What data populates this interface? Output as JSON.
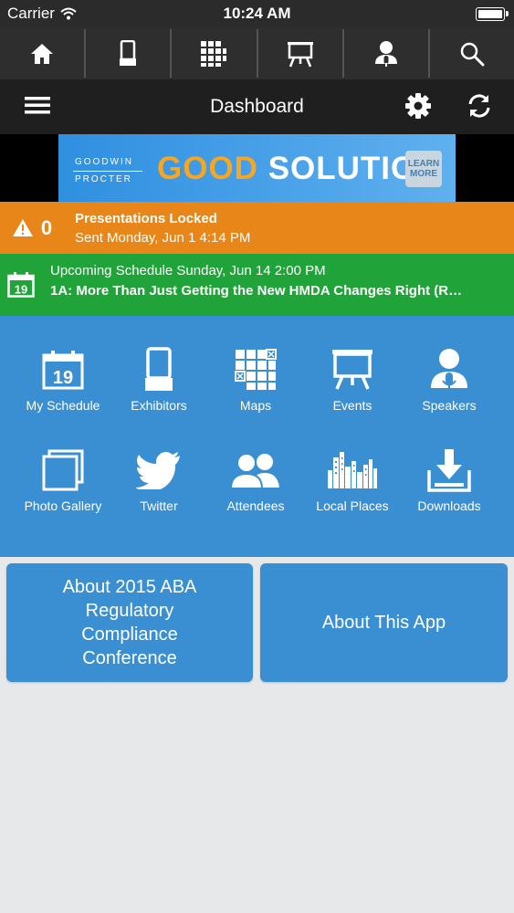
{
  "status_bar": {
    "carrier": "Carrier",
    "time": "10:24 AM"
  },
  "top_nav": [
    {
      "icon": "home-icon"
    },
    {
      "icon": "exhibitors-icon"
    },
    {
      "icon": "maps-icon"
    },
    {
      "icon": "events-icon"
    },
    {
      "icon": "speakers-icon"
    },
    {
      "icon": "search-icon"
    }
  ],
  "title_bar": {
    "title": "Dashboard"
  },
  "banner": {
    "brand_line1": "GOODWIN",
    "brand_line2": "PROCTER",
    "headline_part1": "GOOD",
    "headline_part2": "SOLUTION",
    "learn_line1": "LEARN",
    "learn_line2": "MORE"
  },
  "alert": {
    "count": "0",
    "title": "Presentations Locked",
    "subtitle": "Sent Monday, Jun 1 4:14 PM",
    "color": "#e8861a"
  },
  "schedule": {
    "line1": "Upcoming Schedule Sunday, Jun 14 2:00 PM",
    "line2": "1A: More Than Just Getting the New HMDA Changes Right (R…",
    "day": "19",
    "color": "#20a338"
  },
  "grid": {
    "color": "#3a8fd3",
    "items": [
      {
        "label": "My Schedule",
        "icon": "calendar-icon"
      },
      {
        "label": "Exhibitors",
        "icon": "exhibitors-icon"
      },
      {
        "label": "Maps",
        "icon": "maps-icon"
      },
      {
        "label": "Events",
        "icon": "events-icon"
      },
      {
        "label": "Speakers",
        "icon": "speakers-icon"
      },
      {
        "label": "Photo Gallery",
        "icon": "photo-gallery-icon"
      },
      {
        "label": "Twitter",
        "icon": "twitter-icon"
      },
      {
        "label": "Attendees",
        "icon": "attendees-icon"
      },
      {
        "label": "Local Places",
        "icon": "local-places-icon"
      },
      {
        "label": "Downloads",
        "icon": "downloads-icon"
      }
    ]
  },
  "cards": [
    {
      "label": "About 2015 ABA Regulatory Compliance Conference"
    },
    {
      "label": "About This App"
    }
  ]
}
